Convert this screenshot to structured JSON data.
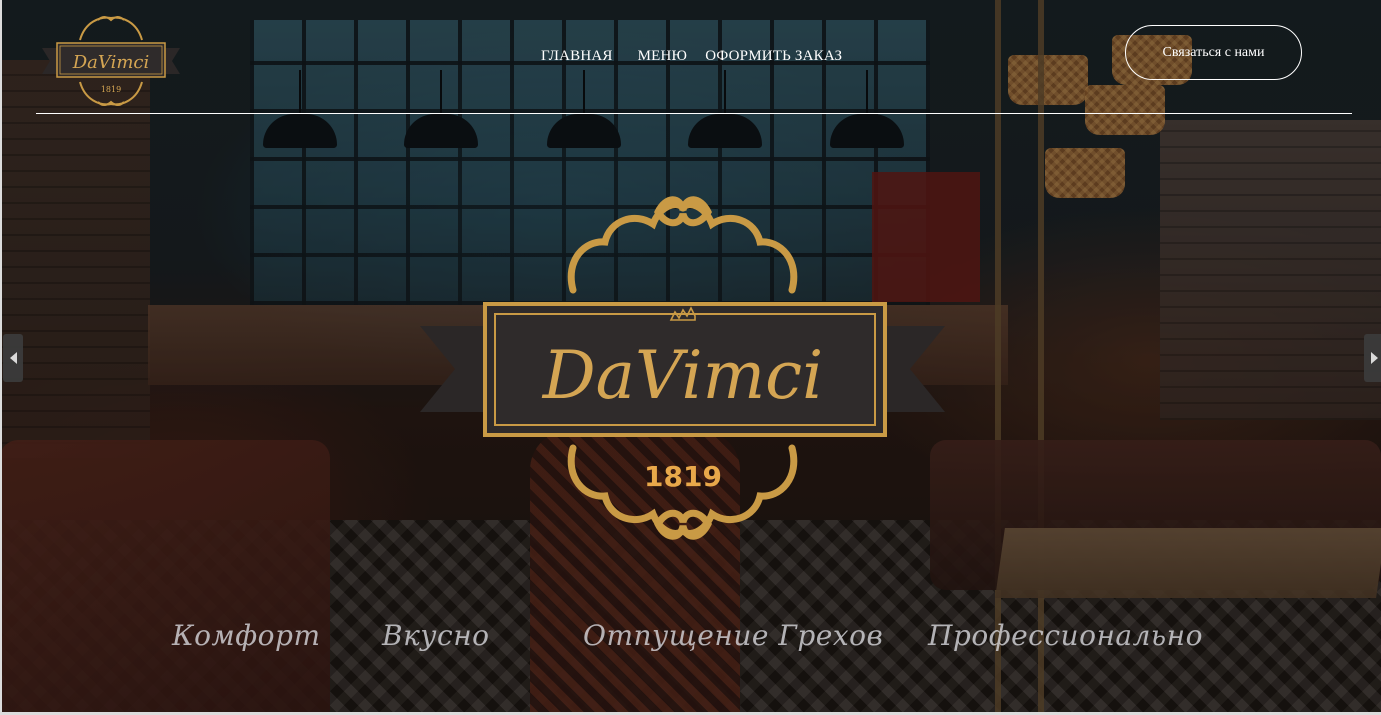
{
  "nav": {
    "items": [
      {
        "label": "ГЛАВНАЯ"
      },
      {
        "label": "МЕНЮ"
      },
      {
        "label": "ОФОРМИТЬ ЗАКАЗ"
      }
    ]
  },
  "header": {
    "contact_label": "Связаться с нами"
  },
  "logo": {
    "name": "DaVimci",
    "year": "1819"
  },
  "taglines": [
    "Комфорт",
    "Вкусно",
    "Отпущение Грехов",
    "Профессионально"
  ],
  "colors": {
    "gold": "#c99a45",
    "logo_banner": "#2f2b2b",
    "text_white": "#ffffff"
  },
  "icons": {
    "prev": "chevron-left-icon",
    "next": "chevron-right-icon"
  }
}
